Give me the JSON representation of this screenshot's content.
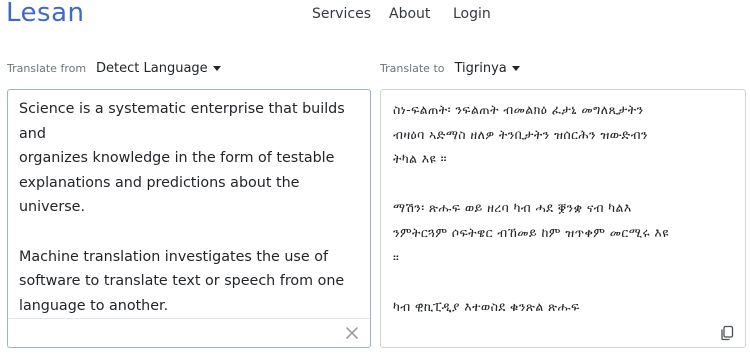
{
  "brand": "Lesan",
  "nav": {
    "services": "Services",
    "about": "About",
    "login": "Login"
  },
  "source": {
    "caption": "Translate from",
    "language": "Detect Language",
    "text": "Science is a systematic enterprise that builds and\norganizes knowledge in the form of testable\nexplanations and predictions about the universe.\n\nMachine translation investigates the use of\nsoftware to translate text or speech from one\nlanguage to another.\n\nExcerpt From Wikipedia"
  },
  "target": {
    "caption": "Translate to",
    "language": "Tigrinya",
    "text": "ስነ-ፍልጠት፡ ንፍልጠት ብመልክዕ ፈታኒ መግለጺታትን\nብዛዕባ ኣድማስ ዘለዎ ትንቢታትን ዝሰርሕን ዝውድብን\nትካል እዩ ።\n\nማሽን፡ ጽሑፍ ወይ ዘረባ ካብ ሓደ ቛንቋ ናብ ካልእ\nንምትርጓም ሶፍትዌር ብኸመይ ከም ዝጥቀም መርሚሩ እዩ\n።\n\nካብ ዊኪፒዲያ እተወስደ ቁንጽል ጽሑፍ"
  },
  "icons": {
    "clear": "close-icon",
    "copy": "copy-icon"
  }
}
